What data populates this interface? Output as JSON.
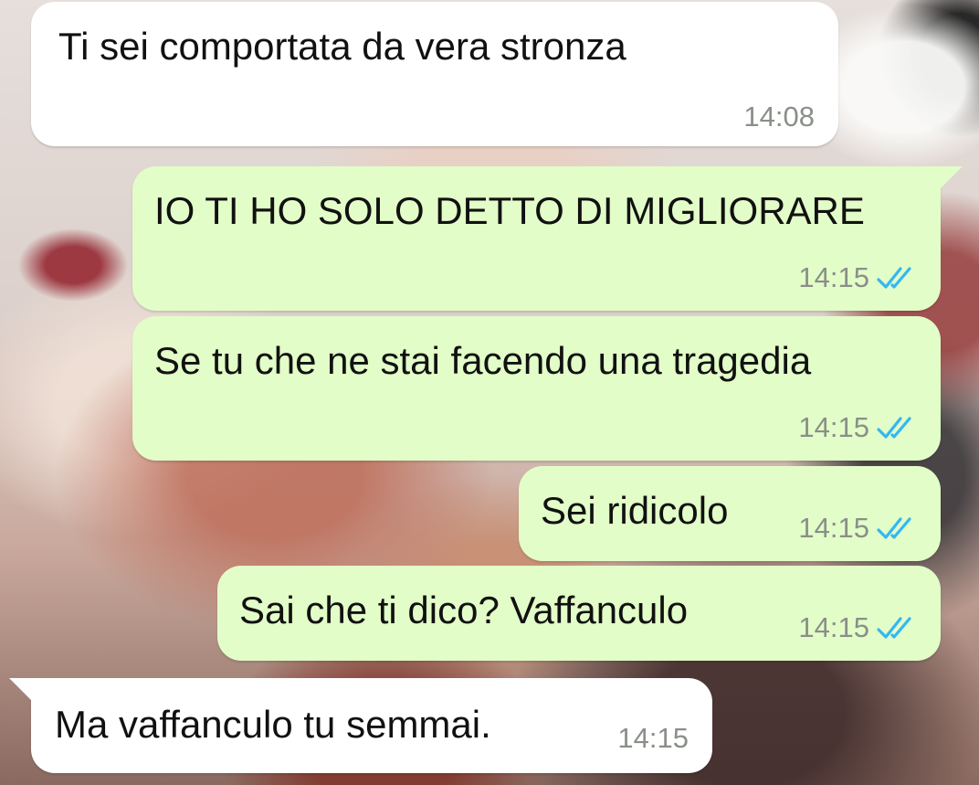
{
  "chat": {
    "messages": [
      {
        "direction": "incoming",
        "text": "Ti sei comportata da vera stronza",
        "time": "14:08",
        "status": ""
      },
      {
        "direction": "outgoing",
        "text": "IO TI HO SOLO DETTO DI MIGLIORARE",
        "time": "14:15",
        "status": "read"
      },
      {
        "direction": "outgoing",
        "text": "Se tu che ne stai facendo una tragedia",
        "time": "14:15",
        "status": "read"
      },
      {
        "direction": "outgoing",
        "text": "Sei ridicolo",
        "time": "14:15",
        "status": "read"
      },
      {
        "direction": "outgoing",
        "text": "Sai che ti dico? Vaffanculo",
        "time": "14:15",
        "status": "read"
      },
      {
        "direction": "incoming",
        "text": "Ma vaffanculo tu semmai.",
        "time": "14:15",
        "status": ""
      }
    ]
  },
  "colors": {
    "incoming_bubble": "#ffffff",
    "outgoing_bubble": "#e2fdc8",
    "read_ticks": "#34b7f1",
    "timestamp": "#8a8f88"
  },
  "icons": {
    "read_receipt": "double-check-icon"
  }
}
